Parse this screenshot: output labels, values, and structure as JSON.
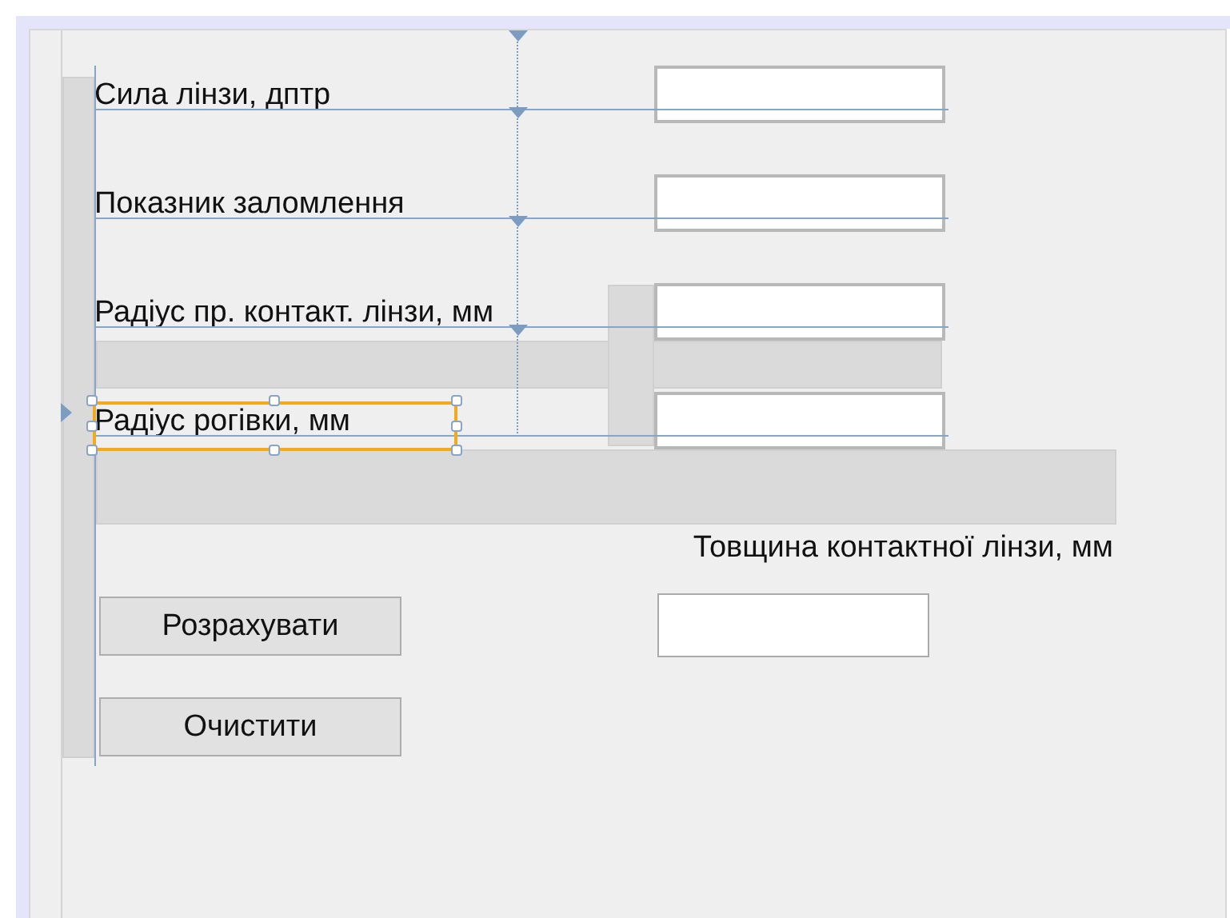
{
  "form_fields": [
    {
      "label": "Сила лінзи, дптр",
      "selected": false
    },
    {
      "label": "Показник заломлення",
      "selected": false
    },
    {
      "label": "Радіус пр. контакт. лінзи, мм",
      "selected": false
    },
    {
      "label": "Радіус рогівки, мм",
      "selected": true
    }
  ],
  "result": {
    "label": "Товщина контактної лінзи, мм"
  },
  "buttons": [
    {
      "label": "Розрахувати"
    },
    {
      "label": "Очистити"
    }
  ]
}
